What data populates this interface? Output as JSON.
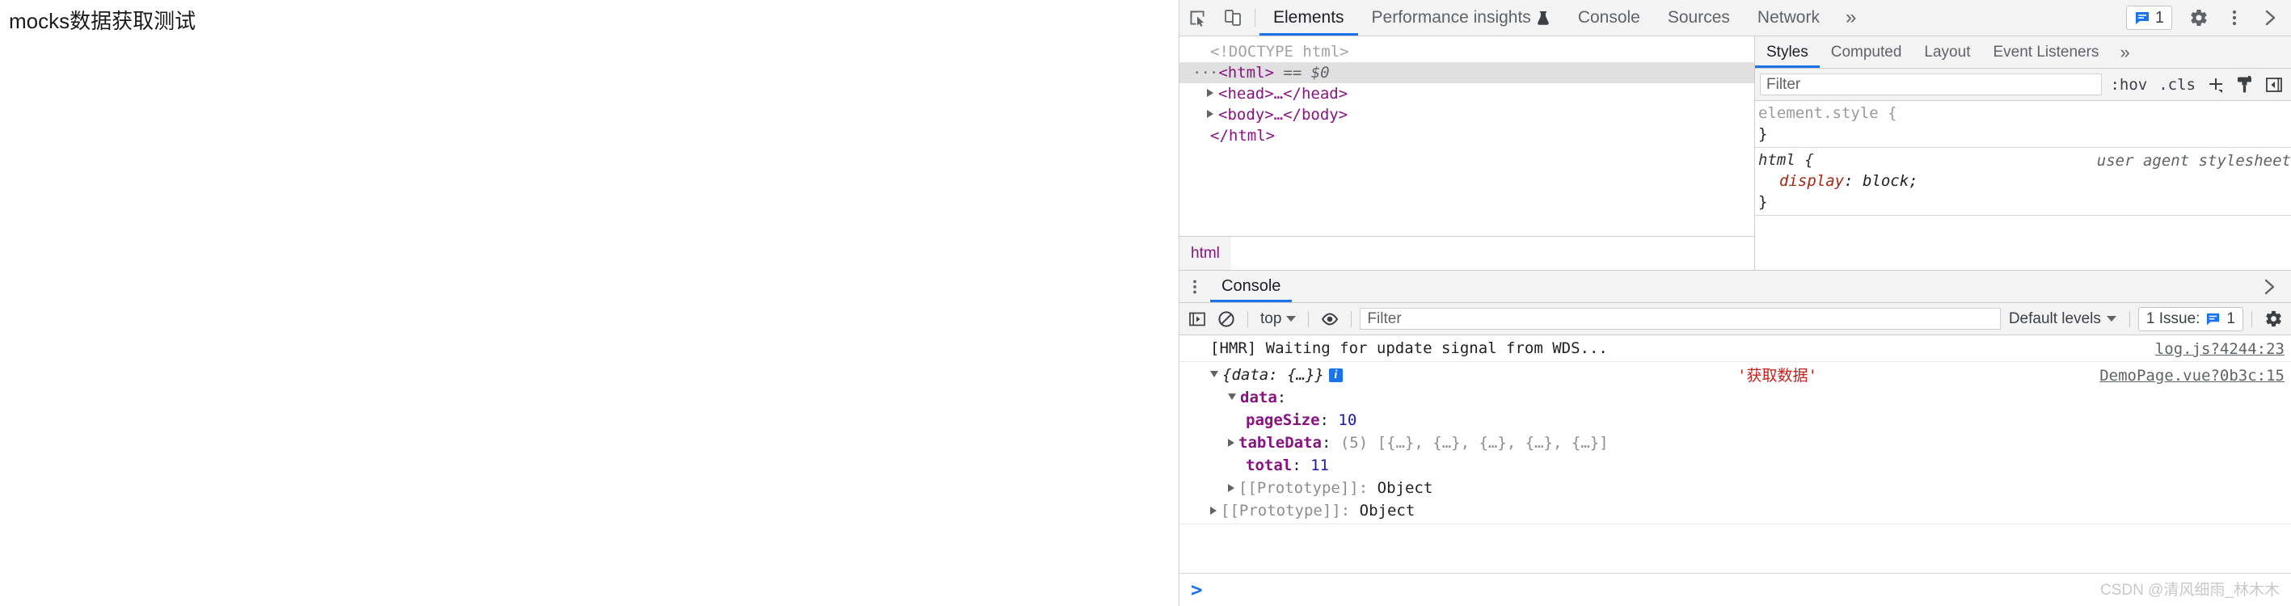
{
  "page": {
    "heading": "mocks数据获取测试"
  },
  "devtools": {
    "toolbar": {
      "inspect_icon": "inspect-element-icon",
      "device_icon": "device-toolbar-icon",
      "tabs": [
        {
          "label": "Elements",
          "active": true,
          "experiment": false
        },
        {
          "label": "Performance insights",
          "active": false,
          "experiment": true
        },
        {
          "label": "Console",
          "active": false,
          "experiment": false
        },
        {
          "label": "Sources",
          "active": false,
          "experiment": false
        },
        {
          "label": "Network",
          "active": false,
          "experiment": false
        }
      ],
      "more_tabs": "»",
      "issues_count": "1",
      "settings_icon": "gear-icon",
      "kebab_icon": "more-options-icon",
      "close_icon": "close-devtools-icon"
    },
    "elements": {
      "doctype": "<!DOCTYPE html>",
      "nodes": [
        {
          "dots": "···",
          "text": "<html>",
          "suffix": " == $0",
          "selected": true
        },
        {
          "text": "<head>…</head>",
          "expandable": true
        },
        {
          "text": "<body>…</body>",
          "expandable": true
        },
        {
          "text": "</html>"
        }
      ],
      "breadcrumb": [
        "html"
      ]
    },
    "styles": {
      "tabs": [
        {
          "label": "Styles",
          "active": true
        },
        {
          "label": "Computed",
          "active": false
        },
        {
          "label": "Layout",
          "active": false
        },
        {
          "label": "Event Listeners",
          "active": false
        }
      ],
      "more_tabs": "»",
      "filter_placeholder": "Filter",
      "filter_value": "",
      "hov_label": ":hov",
      "cls_label": ".cls",
      "new_rule_icon": "plus-icon",
      "class_icon": "paint-brush-icon",
      "sidebar_toggle_icon": "toggle-sidebar-icon",
      "rules": [
        {
          "selector": "element.style",
          "origin": "",
          "open_brace": "{",
          "close_brace": "}",
          "declarations": []
        },
        {
          "selector": "html",
          "origin": "user agent stylesheet",
          "open_brace": "{",
          "close_brace": "}",
          "declarations": [
            {
              "name": "display",
              "value": "block"
            }
          ]
        }
      ]
    },
    "drawer": {
      "kebab_icon": "more-tools-icon",
      "tabs": [
        {
          "label": "Console",
          "active": true
        }
      ],
      "close_icon": "close-drawer-icon",
      "console_toolbar": {
        "sidebar_icon": "console-sidebar-icon",
        "clear_icon": "clear-console-icon",
        "context": "top",
        "eye_icon": "live-expression-icon",
        "filter_placeholder": "Filter",
        "filter_value": "",
        "levels": "Default levels",
        "issues_label": "1 Issue:",
        "issues_count": "1",
        "settings_icon": "console-settings-icon"
      },
      "messages": [
        {
          "kind": "log",
          "text": "[HMR] Waiting for update signal from WDS...",
          "source": "log.js?4244:23",
          "annotation": ""
        },
        {
          "kind": "object",
          "header": "{data: {…}}",
          "info_badge": "i",
          "annotation": "'获取数据'",
          "source": "DemoPage.vue?0b3c:15",
          "tree": [
            {
              "indent": 1,
              "toggle": "down",
              "key": "data",
              "sep": ":",
              "value": ""
            },
            {
              "indent": 2,
              "toggle": "none",
              "key": "pageSize",
              "sep": ":",
              "value": "10",
              "value_type": "number"
            },
            {
              "indent": 2,
              "toggle": "right",
              "key": "tableData",
              "sep": ":",
              "value": "(5) [{…}, {…}, {…}, {…}, {…}]",
              "value_type": "array"
            },
            {
              "indent": 2,
              "toggle": "none",
              "key": "total",
              "sep": ":",
              "value": "11",
              "value_type": "number"
            },
            {
              "indent": 2,
              "toggle": "right",
              "key": "[[Prototype]]",
              "sep": ":",
              "value": "Object",
              "value_type": "proto"
            },
            {
              "indent": 1,
              "toggle": "right",
              "key": "[[Prototype]]",
              "sep": ":",
              "value": "Object",
              "value_type": "proto"
            }
          ]
        }
      ],
      "prompt_caret": ">"
    }
  },
  "watermark": "CSDN @清风细雨_林木木",
  "colors": {
    "accent_blue": "#1a73e8",
    "tag_purple": "#881280",
    "prop_red": "#a52714",
    "annotation_red": "#c5221f",
    "number_blue": "#1a1aa6",
    "toolbar_bg": "#f3f3f3",
    "border": "#cdcdcd"
  }
}
